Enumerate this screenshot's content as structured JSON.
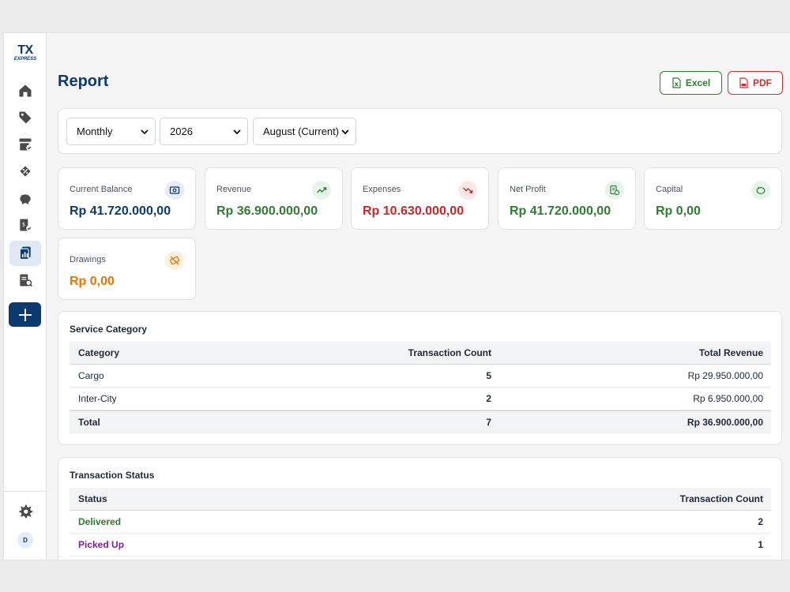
{
  "brand": {
    "logo_main": "TX",
    "logo_sub": "EXPRESS"
  },
  "sidebar": {
    "items": [
      {
        "name": "home-icon"
      },
      {
        "name": "tag-icon"
      },
      {
        "name": "archive-check-icon"
      },
      {
        "name": "discount-icon"
      },
      {
        "name": "piggy-bank-icon"
      },
      {
        "name": "money-check-icon"
      },
      {
        "name": "report-icon",
        "active": true
      },
      {
        "name": "receipt-search-icon"
      }
    ],
    "add_label": "+",
    "settings_icon": "gear-icon",
    "avatar_initial": "D"
  },
  "header": {
    "title": "Report",
    "excel_label": "Excel",
    "pdf_label": "PDF"
  },
  "filters": {
    "period": "Monthly",
    "year": "2026",
    "month": "August (Current)"
  },
  "stats": [
    {
      "label": "Current Balance",
      "value": "Rp 41.720.000,00",
      "color": "#0b3a6e",
      "icon": "wallet-icon",
      "icon_bg": "#e3ecf7"
    },
    {
      "label": "Revenue",
      "value": "Rp 36.900.000,00",
      "color": "#2e7d32",
      "icon": "trend-up-icon",
      "icon_bg": "#e6f4ea"
    },
    {
      "label": "Expenses",
      "value": "Rp 10.630.000,00",
      "color": "#c62828",
      "icon": "trend-down-icon",
      "icon_bg": "#fde8e8"
    },
    {
      "label": "Net Profit",
      "value": "Rp 41.720.000,00",
      "color": "#2e7d32",
      "icon": "profit-doc-icon",
      "icon_bg": "#e6f4ea"
    },
    {
      "label": "Capital",
      "value": "Rp 0,00",
      "color": "#2e7d32",
      "icon": "piggy-bank-icon",
      "icon_bg": "#e6f4ea"
    },
    {
      "label": "Drawings",
      "value": "Rp 0,00",
      "color": "#e67700",
      "icon": "money-off-icon",
      "icon_bg": "#fdf0dc"
    }
  ],
  "service_category": {
    "title": "Service Category",
    "columns": [
      "Category",
      "Transaction Count",
      "Total Revenue"
    ],
    "rows": [
      {
        "category": "Cargo",
        "count": "5",
        "revenue": "Rp 29.950.000,00"
      },
      {
        "category": "Inter-City",
        "count": "2",
        "revenue": "Rp 6.950.000,00"
      }
    ],
    "total": {
      "label": "Total",
      "count": "7",
      "revenue": "Rp 36.900.000,00"
    }
  },
  "transaction_status": {
    "title": "Transaction Status",
    "columns": [
      "Status",
      "Transaction Count"
    ],
    "rows": [
      {
        "status": "Delivered",
        "count": "2",
        "color": "#2e7d32"
      },
      {
        "status": "Picked Up",
        "count": "1",
        "color": "#7b1fa2"
      }
    ]
  }
}
